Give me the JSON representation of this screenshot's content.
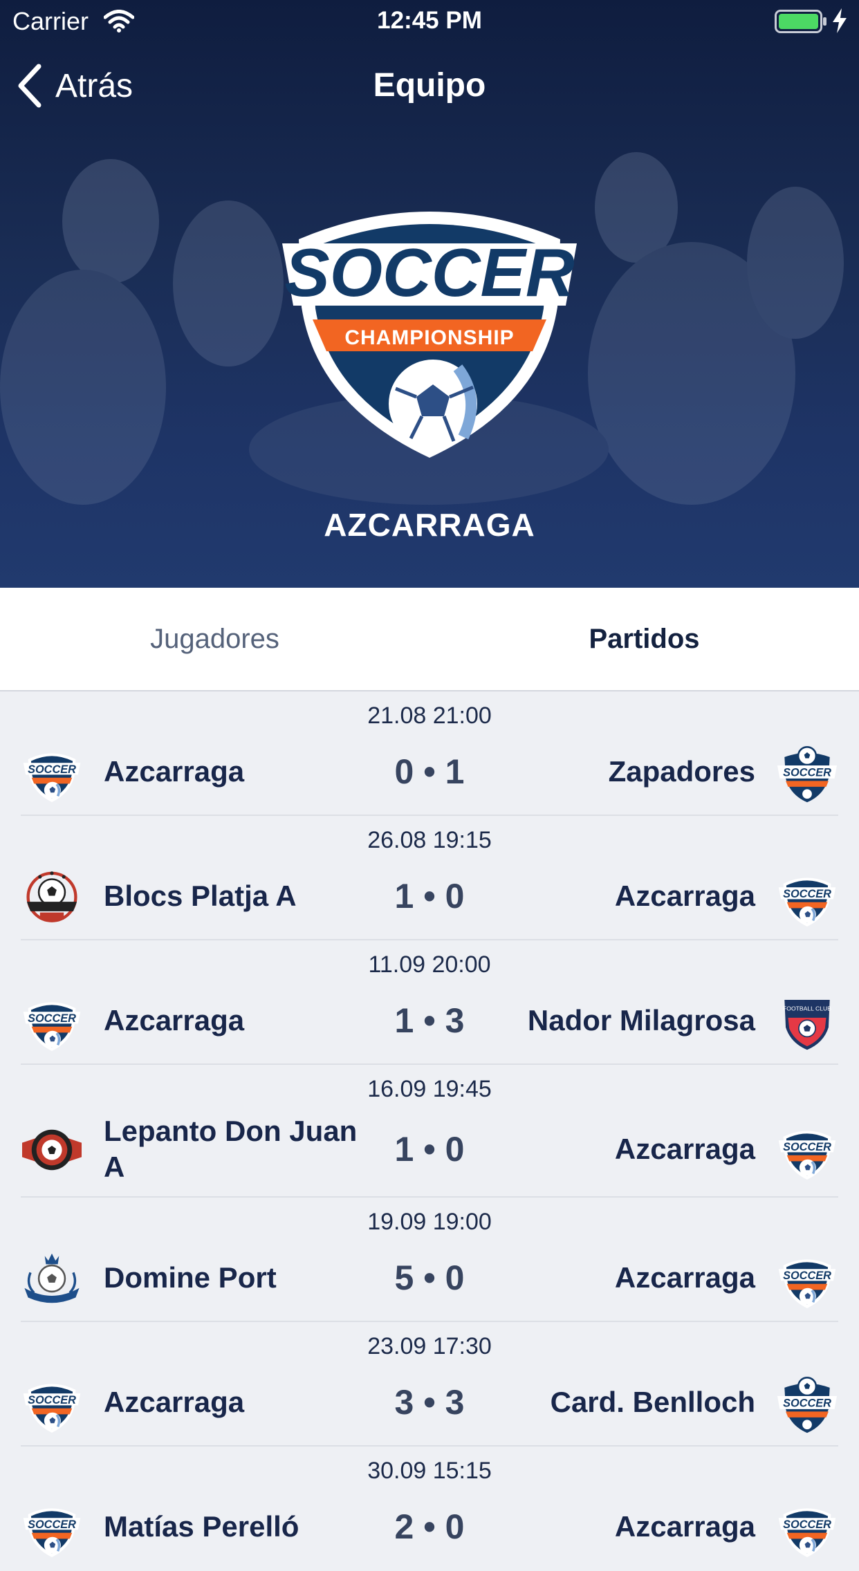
{
  "status_bar": {
    "carrier": "Carrier",
    "time": "12:45 PM",
    "battery_color": "#4cd964"
  },
  "nav": {
    "back_label": "Atrás",
    "title": "Equipo"
  },
  "team": {
    "name": "AZCARRAGA",
    "crest_text_top": "SOCCER",
    "crest_text_band": "CHAMPIONSHIP"
  },
  "tabs": [
    {
      "label": "Jugadores",
      "active": false
    },
    {
      "label": "Partidos",
      "active": true
    }
  ],
  "colors": {
    "header_dark": "#0f1d3f",
    "header_light": "#213a6e",
    "accent_orange": "#f26522",
    "text_dark": "#18264a"
  },
  "matches": [
    {
      "date": "21.08 21:00",
      "home": "Azcarraga",
      "home_icon": "soccer-crest-icon",
      "score": "0 • 1",
      "away": "Zapadores",
      "away_icon": "soccer-ball-crest-icon"
    },
    {
      "date": "26.08 19:15",
      "home": "Blocs Platja A",
      "home_icon": "football-club-badge-icon",
      "score": "1 • 0",
      "away": "Azcarraga",
      "away_icon": "soccer-crest-icon"
    },
    {
      "date": "11.09 20:00",
      "home": "Azcarraga",
      "home_icon": "soccer-crest-icon",
      "score": "1 • 3",
      "away": "Nador Milagrosa",
      "away_icon": "shield-badge-icon"
    },
    {
      "date": "16.09 19:45",
      "home": "Lepanto Don Juan A",
      "home_icon": "winged-ball-badge-icon",
      "score": "1 • 0",
      "away": "Azcarraga",
      "away_icon": "soccer-crest-icon"
    },
    {
      "date": "19.09 19:00",
      "home": "Domine Port",
      "home_icon": "crowned-ball-badge-icon",
      "score": "5 • 0",
      "away": "Azcarraga",
      "away_icon": "soccer-crest-icon"
    },
    {
      "date": "23.09 17:30",
      "home": "Azcarraga",
      "home_icon": "soccer-crest-icon",
      "score": "3 • 3",
      "away": "Card. Benlloch",
      "away_icon": "soccer-ball-crest-icon"
    },
    {
      "date": "30.09 15:15",
      "home": "Matías Perelló",
      "home_icon": "soccer-crest-icon",
      "score": "2 • 0",
      "away": "Azcarraga",
      "away_icon": "soccer-crest-icon"
    }
  ]
}
